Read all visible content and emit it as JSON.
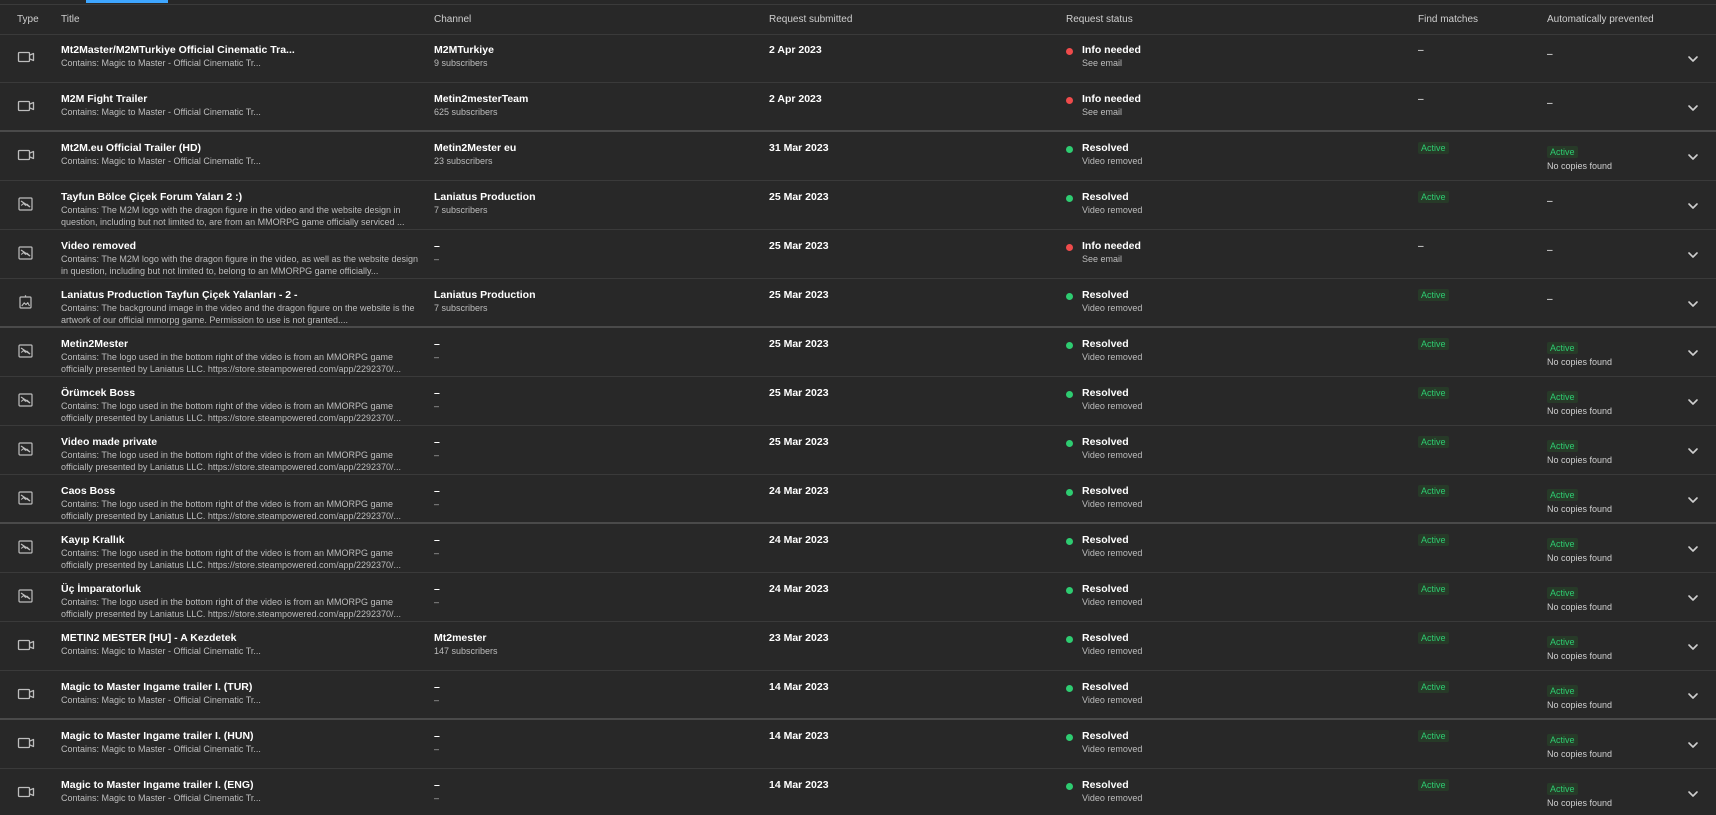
{
  "top_tab": {
    "active": true
  },
  "header": {
    "type": "Type",
    "title": "Title",
    "channel": "Channel",
    "request_submitted": "Request submitted",
    "request_status": "Request status",
    "find_matches": "Find matches",
    "automatically_prevented": "Automatically prevented"
  },
  "colors": {
    "background": "#282828",
    "text": "#ffffff",
    "secondary_text": "#bdbdbd",
    "divider": "#3a3a3a",
    "info_needed": "#ef4b4b",
    "resolved": "#2ecc71",
    "active": "#2ecc71",
    "tab_indicator": "#3ea6ff"
  },
  "rows": [
    {
      "type_icon": "video-icon",
      "title": "Mt2Master/M2MTurkiye Official Cinematic Tra...",
      "description": "Contains: Magic to Master - Official Cinematic Tr...",
      "channel": "M2MTurkiye",
      "channel_subscribers": "9 subscribers",
      "request_submitted": "2 Apr 2023",
      "status": "Info needed",
      "status_detail": "See email",
      "status_color": "#ef4b4b",
      "find_matches": "–",
      "find_matches_active": false,
      "automatically_prevented": "–",
      "automatically_prevented_active": false,
      "automatically_prevented_detail": "",
      "thick_divider": false
    },
    {
      "type_icon": "video-icon",
      "title": "M2M Fight Trailer",
      "description": "Contains: Magic to Master - Official Cinematic Tr...",
      "channel": "Metin2mesterTeam",
      "channel_subscribers": "625 subscribers",
      "request_submitted": "2 Apr 2023",
      "status": "Info needed",
      "status_detail": "See email",
      "status_color": "#ef4b4b",
      "find_matches": "–",
      "find_matches_active": false,
      "automatically_prevented": "–",
      "automatically_prevented_active": false,
      "automatically_prevented_detail": "",
      "thick_divider": true
    },
    {
      "type_icon": "video-icon",
      "title": "Mt2M.eu Official Trailer (HD)",
      "description": "Contains: Magic to Master - Official Cinematic Tr...",
      "channel": "Metin2Mester eu",
      "channel_subscribers": "23 subscribers",
      "request_submitted": "31 Mar 2023",
      "status": "Resolved",
      "status_detail": "Video removed",
      "status_color": "#2ecc71",
      "find_matches": "Active",
      "find_matches_active": true,
      "automatically_prevented": "Active",
      "automatically_prevented_active": true,
      "automatically_prevented_detail": "No copies found",
      "thick_divider": false
    },
    {
      "type_icon": "image-icon",
      "title": "Tayfun Bölce Çiçek Forum Yaları 2 :)",
      "description": "Contains: The M2M logo with the dragon figure in the video and the website design in question, including but not limited to, are from an MMORPG game officially serviced ...",
      "channel": "Laniatus Production",
      "channel_subscribers": "7 subscribers",
      "request_submitted": "25 Mar 2023",
      "status": "Resolved",
      "status_detail": "Video removed",
      "status_color": "#2ecc71",
      "find_matches": "Active",
      "find_matches_active": true,
      "automatically_prevented": "–",
      "automatically_prevented_active": false,
      "automatically_prevented_detail": "",
      "thick_divider": false
    },
    {
      "type_icon": "image-icon",
      "title": "Video removed",
      "description": "Contains: The M2M logo with the dragon figure in the video, as well as the website design in question, including but not limited to, belong to an MMORPG game officially...",
      "channel": "–",
      "channel_subscribers": "–",
      "request_submitted": "25 Mar 2023",
      "status": "Info needed",
      "status_detail": "See email",
      "status_color": "#ef4b4b",
      "find_matches": "–",
      "find_matches_active": false,
      "automatically_prevented": "–",
      "automatically_prevented_active": false,
      "automatically_prevented_detail": "",
      "thick_divider": false
    },
    {
      "type_icon": "artwork-icon",
      "title": "Laniatus Production Tayfun Çiçek Yalanları - 2 -",
      "description": "Contains: The background image in the video and the dragon figure on the website is the artwork of our official mmorpg game. Permission to use is not granted....",
      "channel": "Laniatus Production",
      "channel_subscribers": "7 subscribers",
      "request_submitted": "25 Mar 2023",
      "status": "Resolved",
      "status_detail": "Video removed",
      "status_color": "#2ecc71",
      "find_matches": "Active",
      "find_matches_active": true,
      "automatically_prevented": "–",
      "automatically_prevented_active": false,
      "automatically_prevented_detail": "",
      "thick_divider": true
    },
    {
      "type_icon": "image-icon",
      "title": "Metin2Mester",
      "description": "Contains: The logo used in the bottom right of the video is from an MMORPG game officially presented by Laniatus LLC. https://store.steampowered.com/app/2292370/...",
      "channel": "–",
      "channel_subscribers": "–",
      "request_submitted": "25 Mar 2023",
      "status": "Resolved",
      "status_detail": "Video removed",
      "status_color": "#2ecc71",
      "find_matches": "Active",
      "find_matches_active": true,
      "automatically_prevented": "Active",
      "automatically_prevented_active": true,
      "automatically_prevented_detail": "No copies found",
      "thick_divider": false
    },
    {
      "type_icon": "image-icon",
      "title": "Örümcek Boss",
      "description": "Contains: The logo used in the bottom right of the video is from an MMORPG game officially presented by Laniatus LLC. https://store.steampowered.com/app/2292370/...",
      "channel": "–",
      "channel_subscribers": "–",
      "request_submitted": "25 Mar 2023",
      "status": "Resolved",
      "status_detail": "Video removed",
      "status_color": "#2ecc71",
      "find_matches": "Active",
      "find_matches_active": true,
      "automatically_prevented": "Active",
      "automatically_prevented_active": true,
      "automatically_prevented_detail": "No copies found",
      "thick_divider": false
    },
    {
      "type_icon": "image-icon",
      "title": "Video made private",
      "description": "Contains: The logo used in the bottom right of the video is from an MMORPG game officially presented by Laniatus LLC. https://store.steampowered.com/app/2292370/...",
      "channel": "–",
      "channel_subscribers": "–",
      "request_submitted": "25 Mar 2023",
      "status": "Resolved",
      "status_detail": "Video removed",
      "status_color": "#2ecc71",
      "find_matches": "Active",
      "find_matches_active": true,
      "automatically_prevented": "Active",
      "automatically_prevented_active": true,
      "automatically_prevented_detail": "No copies found",
      "thick_divider": false
    },
    {
      "type_icon": "image-icon",
      "title": "Caos Boss",
      "description": "Contains: The logo used in the bottom right of the video is from an MMORPG game officially presented by Laniatus LLC. https://store.steampowered.com/app/2292370/...",
      "channel": "–",
      "channel_subscribers": "–",
      "request_submitted": "24 Mar 2023",
      "status": "Resolved",
      "status_detail": "Video removed",
      "status_color": "#2ecc71",
      "find_matches": "Active",
      "find_matches_active": true,
      "automatically_prevented": "Active",
      "automatically_prevented_active": true,
      "automatically_prevented_detail": "No copies found",
      "thick_divider": true
    },
    {
      "type_icon": "image-icon",
      "title": "Kayıp Krallık",
      "description": "Contains: The logo used in the bottom right of the video is from an MMORPG game officially presented by Laniatus LLC. https://store.steampowered.com/app/2292370/...",
      "channel": "–",
      "channel_subscribers": "–",
      "request_submitted": "24 Mar 2023",
      "status": "Resolved",
      "status_detail": "Video removed",
      "status_color": "#2ecc71",
      "find_matches": "Active",
      "find_matches_active": true,
      "automatically_prevented": "Active",
      "automatically_prevented_active": true,
      "automatically_prevented_detail": "No copies found",
      "thick_divider": false
    },
    {
      "type_icon": "image-icon",
      "title": "Üç İmparatorluk",
      "description": "Contains: The logo used in the bottom right of the video is from an MMORPG game officially presented by Laniatus LLC. https://store.steampowered.com/app/2292370/...",
      "channel": "–",
      "channel_subscribers": "–",
      "request_submitted": "24 Mar 2023",
      "status": "Resolved",
      "status_detail": "Video removed",
      "status_color": "#2ecc71",
      "find_matches": "Active",
      "find_matches_active": true,
      "automatically_prevented": "Active",
      "automatically_prevented_active": true,
      "automatically_prevented_detail": "No copies found",
      "thick_divider": false
    },
    {
      "type_icon": "video-icon",
      "title": "METIN2 MESTER [HU] - A Kezdetek",
      "description": "Contains: Magic to Master - Official Cinematic Tr...",
      "channel": "Mt2mester",
      "channel_subscribers": "147 subscribers",
      "request_submitted": "23 Mar 2023",
      "status": "Resolved",
      "status_detail": "Video removed",
      "status_color": "#2ecc71",
      "find_matches": "Active",
      "find_matches_active": true,
      "automatically_prevented": "Active",
      "automatically_prevented_active": true,
      "automatically_prevented_detail": "No copies found",
      "thick_divider": false
    },
    {
      "type_icon": "video-icon",
      "title": "Magic to Master Ingame trailer I. (TUR)",
      "description": "Contains: Magic to Master - Official Cinematic Tr...",
      "channel": "–",
      "channel_subscribers": "–",
      "request_submitted": "14 Mar 2023",
      "status": "Resolved",
      "status_detail": "Video removed",
      "status_color": "#2ecc71",
      "find_matches": "Active",
      "find_matches_active": true,
      "automatically_prevented": "Active",
      "automatically_prevented_active": true,
      "automatically_prevented_detail": "No copies found",
      "thick_divider": true
    },
    {
      "type_icon": "video-icon",
      "title": "Magic to Master Ingame trailer I. (HUN)",
      "description": "Contains: Magic to Master - Official Cinematic Tr...",
      "channel": "–",
      "channel_subscribers": "–",
      "request_submitted": "14 Mar 2023",
      "status": "Resolved",
      "status_detail": "Video removed",
      "status_color": "#2ecc71",
      "find_matches": "Active",
      "find_matches_active": true,
      "automatically_prevented": "Active",
      "automatically_prevented_active": true,
      "automatically_prevented_detail": "No copies found",
      "thick_divider": false
    },
    {
      "type_icon": "video-icon",
      "title": "Magic to Master Ingame trailer I. (ENG)",
      "description": "Contains: Magic to Master - Official Cinematic Tr...",
      "channel": "–",
      "channel_subscribers": "–",
      "request_submitted": "14 Mar 2023",
      "status": "Resolved",
      "status_detail": "Video removed",
      "status_color": "#2ecc71",
      "find_matches": "Active",
      "find_matches_active": true,
      "automatically_prevented": "Active",
      "automatically_prevented_active": true,
      "automatically_prevented_detail": "No copies found",
      "thick_divider": false
    }
  ]
}
